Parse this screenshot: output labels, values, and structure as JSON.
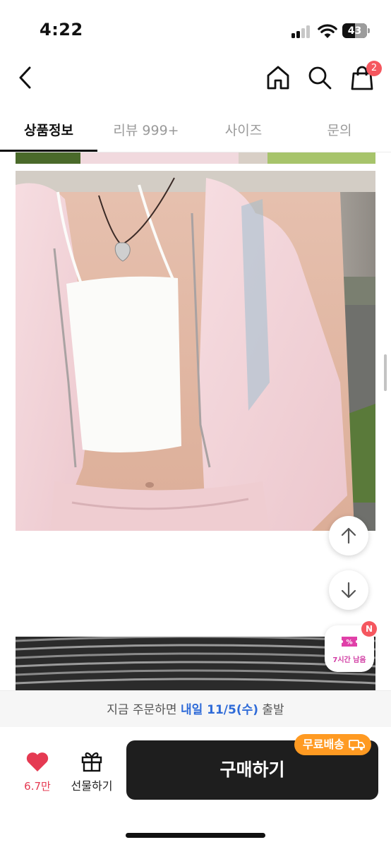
{
  "status_bar": {
    "time": "4:22",
    "battery_level": "43"
  },
  "nav": {
    "cart_count": "2"
  },
  "tabs": [
    {
      "label": "상품정보",
      "active": true
    },
    {
      "label": "리뷰 999+",
      "active": false
    },
    {
      "label": "사이즈",
      "active": false
    },
    {
      "label": "문의",
      "active": false
    }
  ],
  "coupon": {
    "badge": "N",
    "label": "7시간 남음"
  },
  "delivery": {
    "prefix": "지금 주문하면 ",
    "highlight": "내일 11/5(수)",
    "suffix": " 출발"
  },
  "bottom_bar": {
    "like_count": "6.7만",
    "gift_label": "선물하기",
    "buy_label": "구매하기",
    "free_shipping_label": "무료배송"
  },
  "colors": {
    "accent_red": "#e53a52",
    "badge_red": "#f5575f",
    "delivery_blue": "#2f6bd8",
    "free_shipping_orange": "#ff9a22",
    "buy_button": "#1e1e1e"
  }
}
